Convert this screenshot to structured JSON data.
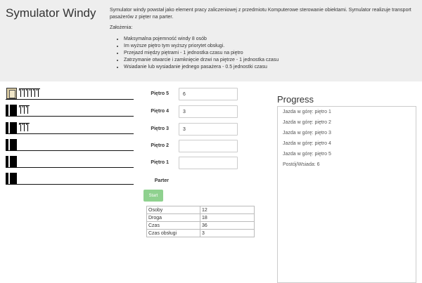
{
  "header": {
    "title": "Symulator Windy",
    "description": "Symulator windy powstał jako element pracy zaliczeniowej z przedmiotu Komputerowe sterowanie obiektami. Symulator realizuje transport pasażerów z pięter na parter.",
    "assumptions_label": "Założenia:",
    "assumptions": [
      "Maksymalna pojemność windy 8 osób",
      "Im wyższe piętro tym wyższy priorytet obsługi.",
      "Przejazd między piętrami - 1 jednostka czasu na piętro",
      "Zatrzymanie otwarcie i zamknięcie drzwi na piętrze - 1 jednostka czasu",
      "Wsiadanie lub wysiadanie jednego pasażera - 0.5 jednostki czasu"
    ]
  },
  "floors": [
    {
      "label": "Piętro 5",
      "value": "6",
      "waiting": 6,
      "car_state": "open"
    },
    {
      "label": "Piętro 4",
      "value": "3",
      "waiting": 3,
      "car_state": "closed"
    },
    {
      "label": "Piętro 3",
      "value": "3",
      "waiting": 3,
      "car_state": "closed"
    },
    {
      "label": "Piętro 2",
      "value": "",
      "waiting": 0,
      "car_state": "closed"
    },
    {
      "label": "Piętro 1",
      "value": "",
      "waiting": 0,
      "car_state": "closed"
    },
    {
      "label": "Parter",
      "value": null,
      "waiting": 0,
      "car_state": "closed"
    }
  ],
  "controls": {
    "start_label": "Start",
    "start_color": "#8fd18f"
  },
  "stats": [
    {
      "key": "Osoby",
      "value": "12"
    },
    {
      "key": "Droga",
      "value": "18"
    },
    {
      "key": "Czas",
      "value": "36"
    },
    {
      "key": "Czas obsługi",
      "value": "3"
    }
  ],
  "progress": {
    "title": "Progress",
    "entries": [
      "Jazda w górę: piętro 1",
      "Jazda w górę: piętro 2",
      "Jazda w górę: piętro 3",
      "Jazda w górę: piętro 4",
      "Jazda w górę: piętro 5",
      "Postój/Wsiada: 6"
    ]
  }
}
